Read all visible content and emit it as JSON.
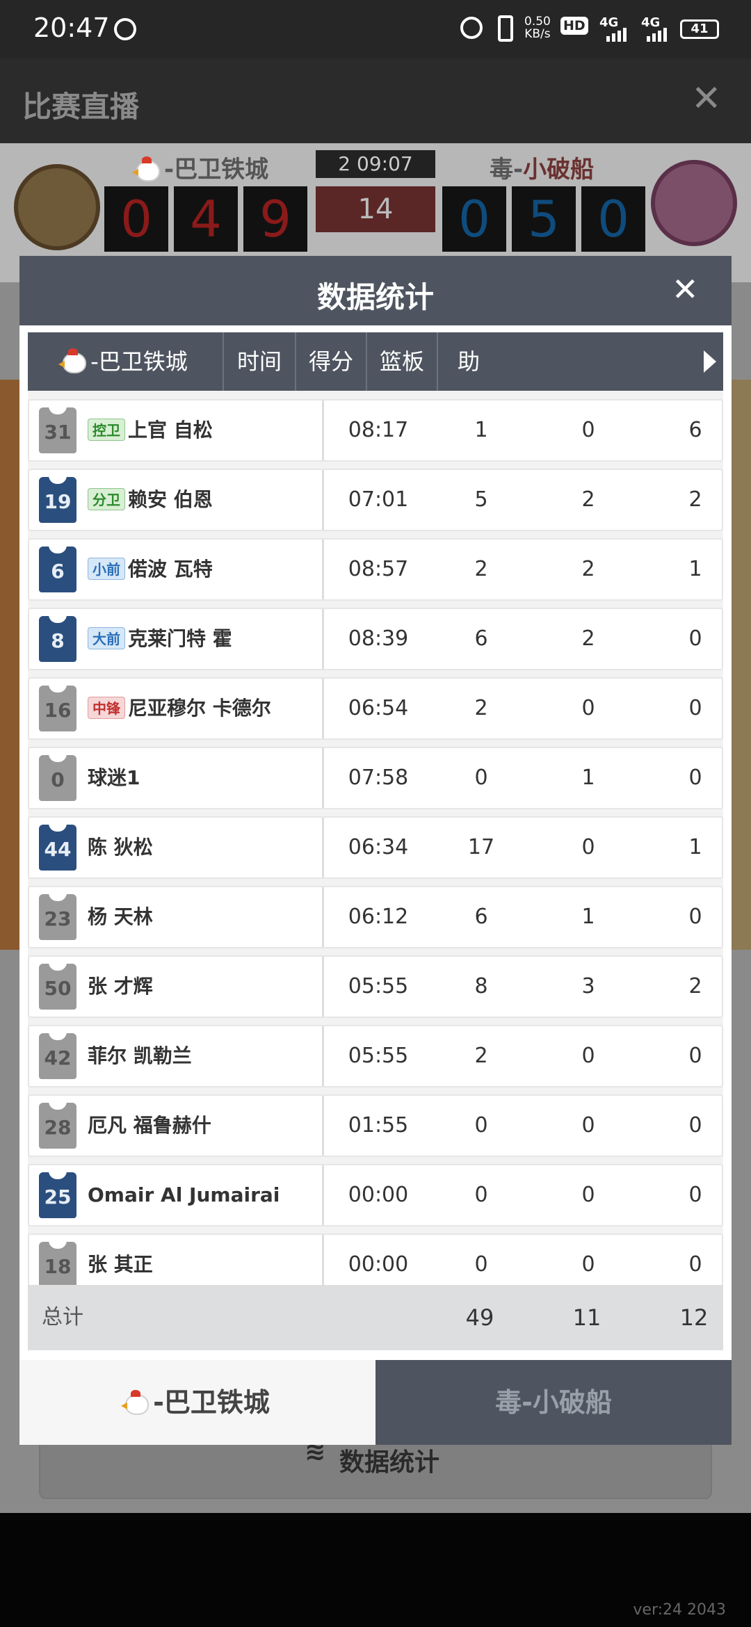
{
  "status_bar": {
    "time": "20:47",
    "net_speed_value": "0.50",
    "net_speed_unit": "KB/s",
    "hd": "HD",
    "sim1": "4G",
    "sim2": "4G",
    "battery": "41"
  },
  "background": {
    "page_title": "比赛直播",
    "home_team_name": "-巴卫铁城",
    "away_team_prefix": "毒-",
    "away_team_name": "小破船",
    "home_score": [
      "0",
      "4",
      "9"
    ],
    "away_score": [
      "0",
      "5",
      "0"
    ],
    "quarter_clock": "2    09:07",
    "shot_clock": "14",
    "stats_button": "数据统计",
    "version": "ver:24  2043"
  },
  "modal": {
    "title": "数据统计",
    "columns": [
      "-巴卫铁城",
      "时间",
      "得分",
      "篮板",
      "助攻"
    ],
    "players": [
      {
        "number": "31",
        "jersey": "grey",
        "position": "控卫",
        "pos_color": "g",
        "name": "上官 自松",
        "time": "08:17",
        "pts": "1",
        "reb": "0",
        "ast": "6"
      },
      {
        "number": "19",
        "jersey": "navy",
        "position": "分卫",
        "pos_color": "g",
        "name": "赖安 伯恩",
        "time": "07:01",
        "pts": "5",
        "reb": "2",
        "ast": "2"
      },
      {
        "number": "6",
        "jersey": "navy",
        "position": "小前",
        "pos_color": "b",
        "name": "偌波 瓦特",
        "time": "08:57",
        "pts": "2",
        "reb": "2",
        "ast": "1"
      },
      {
        "number": "8",
        "jersey": "navy",
        "position": "大前",
        "pos_color": "b",
        "name": "克莱门特 霍",
        "time": "08:39",
        "pts": "6",
        "reb": "2",
        "ast": "0"
      },
      {
        "number": "16",
        "jersey": "grey",
        "position": "中锋",
        "pos_color": "r",
        "name": "尼亚穆尔 卡德尔",
        "time": "06:54",
        "pts": "2",
        "reb": "0",
        "ast": "0"
      },
      {
        "number": "0",
        "jersey": "grey",
        "position": "",
        "pos_color": "",
        "name": "球迷1",
        "time": "07:58",
        "pts": "0",
        "reb": "1",
        "ast": "0"
      },
      {
        "number": "44",
        "jersey": "navy",
        "position": "",
        "pos_color": "",
        "name": "陈 狄松",
        "time": "06:34",
        "pts": "17",
        "reb": "0",
        "ast": "1"
      },
      {
        "number": "23",
        "jersey": "grey",
        "position": "",
        "pos_color": "",
        "name": "杨 天林",
        "time": "06:12",
        "pts": "6",
        "reb": "1",
        "ast": "0"
      },
      {
        "number": "50",
        "jersey": "grey",
        "position": "",
        "pos_color": "",
        "name": "张 才辉",
        "time": "05:55",
        "pts": "8",
        "reb": "3",
        "ast": "2"
      },
      {
        "number": "42",
        "jersey": "grey",
        "position": "",
        "pos_color": "",
        "name": "菲尔 凯勒兰",
        "time": "05:55",
        "pts": "2",
        "reb": "0",
        "ast": "0"
      },
      {
        "number": "28",
        "jersey": "grey",
        "position": "",
        "pos_color": "",
        "name": "厄凡 福鲁赫什",
        "time": "01:55",
        "pts": "0",
        "reb": "0",
        "ast": "0"
      },
      {
        "number": "25",
        "jersey": "navy",
        "position": "",
        "pos_color": "",
        "name": "Omair Al Jumairai",
        "time": "00:00",
        "pts": "0",
        "reb": "0",
        "ast": "0"
      },
      {
        "number": "18",
        "jersey": "grey",
        "position": "",
        "pos_color": "",
        "name": "张 其正",
        "time": "00:00",
        "pts": "0",
        "reb": "0",
        "ast": "0"
      }
    ],
    "totals": {
      "label": "总计",
      "pts": "49",
      "reb": "11",
      "ast": "12"
    },
    "tabs": {
      "home": "-巴卫铁城",
      "away": "毒-小破船"
    }
  }
}
